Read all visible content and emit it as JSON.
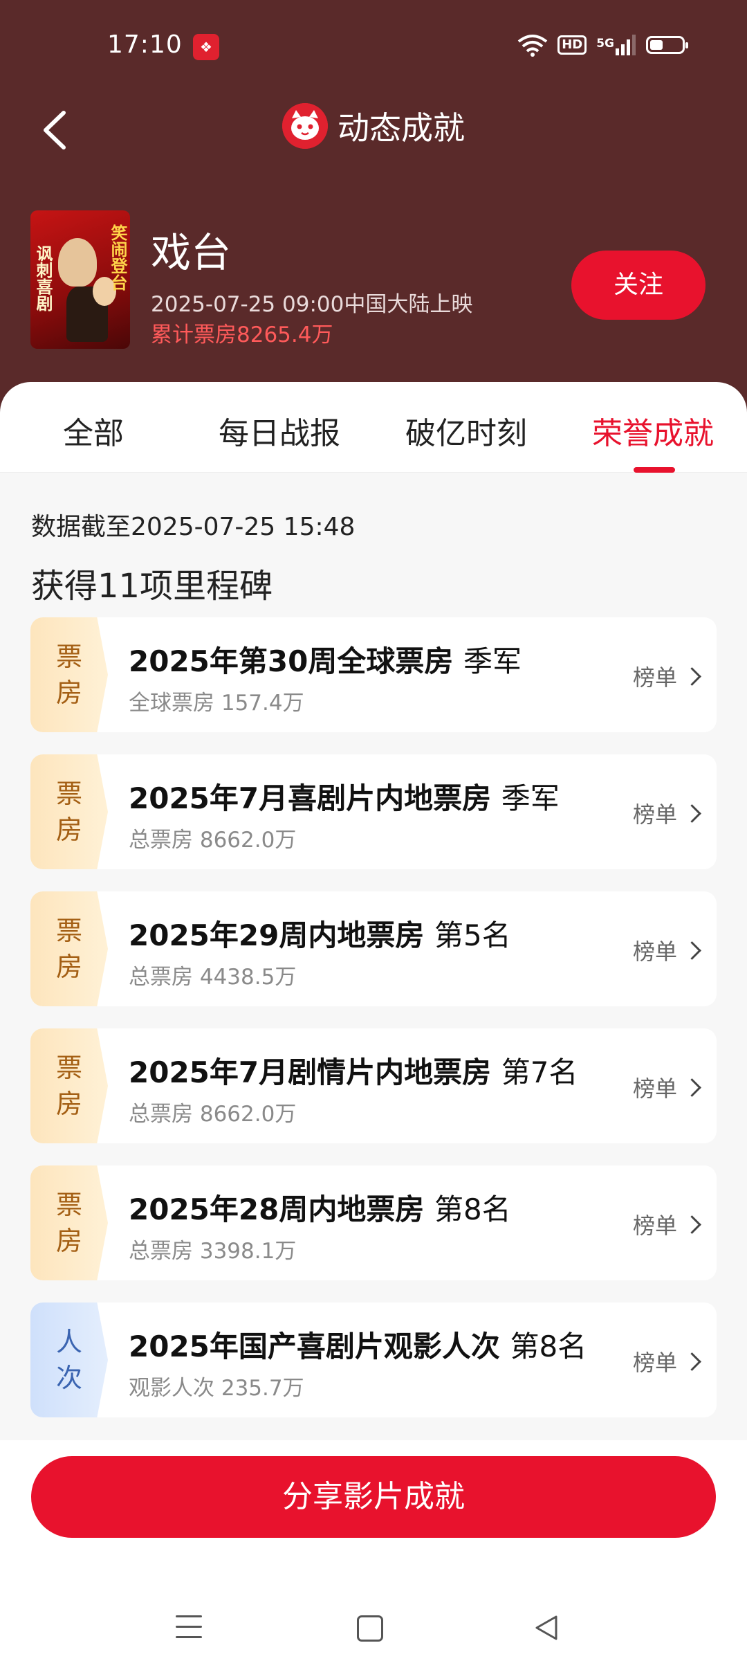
{
  "status": {
    "time": "17:10",
    "hd": "HD",
    "network": "5G"
  },
  "nav": {
    "title": "动态成就"
  },
  "movie": {
    "name": "戏台",
    "release": "2025-07-25 09:00中国大陆上映",
    "total_box_office": "累计票房8265.4万",
    "follow_label": "关注",
    "poster_text_left": "讽刺喜剧",
    "poster_text_right": "笑闹登台"
  },
  "tabs": [
    {
      "label": "全部"
    },
    {
      "label": "每日战报"
    },
    {
      "label": "破亿时刻"
    },
    {
      "label": "荣誉成就"
    }
  ],
  "active_tab": "荣誉成就",
  "data_time": "数据截至2025-07-25  15:48",
  "milestone_count": "获得11项里程碑",
  "milestones": [
    {
      "tag_line1": "票",
      "tag_line2": "房",
      "tag_type": "box",
      "title": "2025年第30周全球票房",
      "rank": "季军",
      "sub": "全球票房 157.4万",
      "link": "榜单"
    },
    {
      "tag_line1": "票",
      "tag_line2": "房",
      "tag_type": "box",
      "title": "2025年7月喜剧片内地票房",
      "rank": "季军",
      "sub": "总票房 8662.0万",
      "link": "榜单"
    },
    {
      "tag_line1": "票",
      "tag_line2": "房",
      "tag_type": "box",
      "title": "2025年29周内地票房",
      "rank": "第5名",
      "sub": "总票房 4438.5万",
      "link": "榜单"
    },
    {
      "tag_line1": "票",
      "tag_line2": "房",
      "tag_type": "box",
      "title": "2025年7月剧情片内地票房",
      "rank": "第7名",
      "sub": "总票房 8662.0万",
      "link": "榜单"
    },
    {
      "tag_line1": "票",
      "tag_line2": "房",
      "tag_type": "box",
      "title": "2025年28周内地票房",
      "rank": "第8名",
      "sub": "总票房 3398.1万",
      "link": "榜单"
    },
    {
      "tag_line1": "人",
      "tag_line2": "次",
      "tag_type": "viewer",
      "title": "2025年国产喜剧片观影人次",
      "rank": "第8名",
      "sub": "观影人次 235.7万",
      "link": "榜单"
    }
  ],
  "share_label": "分享影片成就",
  "colors": {
    "header_bg": "#5a2a2a",
    "accent": "#e8122d",
    "box_tag": "#fde5bd",
    "viewer_tag": "#cfe0fb"
  }
}
